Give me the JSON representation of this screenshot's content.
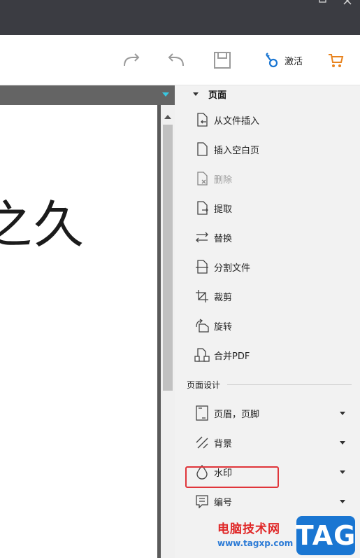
{
  "toolbar": {
    "activate_label": "激活"
  },
  "document": {
    "visible_text": "之久"
  },
  "pages_section": {
    "title": "页面",
    "items": [
      {
        "label": "从文件插入",
        "icon": "insert-from-file-icon"
      },
      {
        "label": "插入空白页",
        "icon": "blank-page-icon"
      },
      {
        "label": "删除",
        "icon": "delete-page-icon",
        "disabled": true
      },
      {
        "label": "提取",
        "icon": "extract-page-icon"
      },
      {
        "label": "替换",
        "icon": "replace-icon"
      },
      {
        "label": "分割文件",
        "icon": "split-file-icon"
      },
      {
        "label": "裁剪",
        "icon": "crop-icon"
      },
      {
        "label": "旋转",
        "icon": "rotate-icon"
      },
      {
        "label": "合并PDF",
        "icon": "merge-pdf-icon"
      }
    ]
  },
  "design_section": {
    "title": "页面设计",
    "items": [
      {
        "label": "页眉，页脚",
        "icon": "header-footer-icon"
      },
      {
        "label": "背景",
        "icon": "background-icon"
      },
      {
        "label": "水印",
        "icon": "watermark-icon"
      },
      {
        "label": "编号",
        "icon": "numbering-icon"
      }
    ]
  },
  "watermark_overlay": {
    "title": "电脑技术网",
    "url": "www.tagxp.com",
    "tag": "TAG"
  },
  "colors": {
    "titlebar": "#3b3c42",
    "panel_bg": "#f2f2f2",
    "highlight_red": "#e0353a",
    "accent_orange": "#e8831e",
    "accent_blue": "#1a76d2"
  }
}
